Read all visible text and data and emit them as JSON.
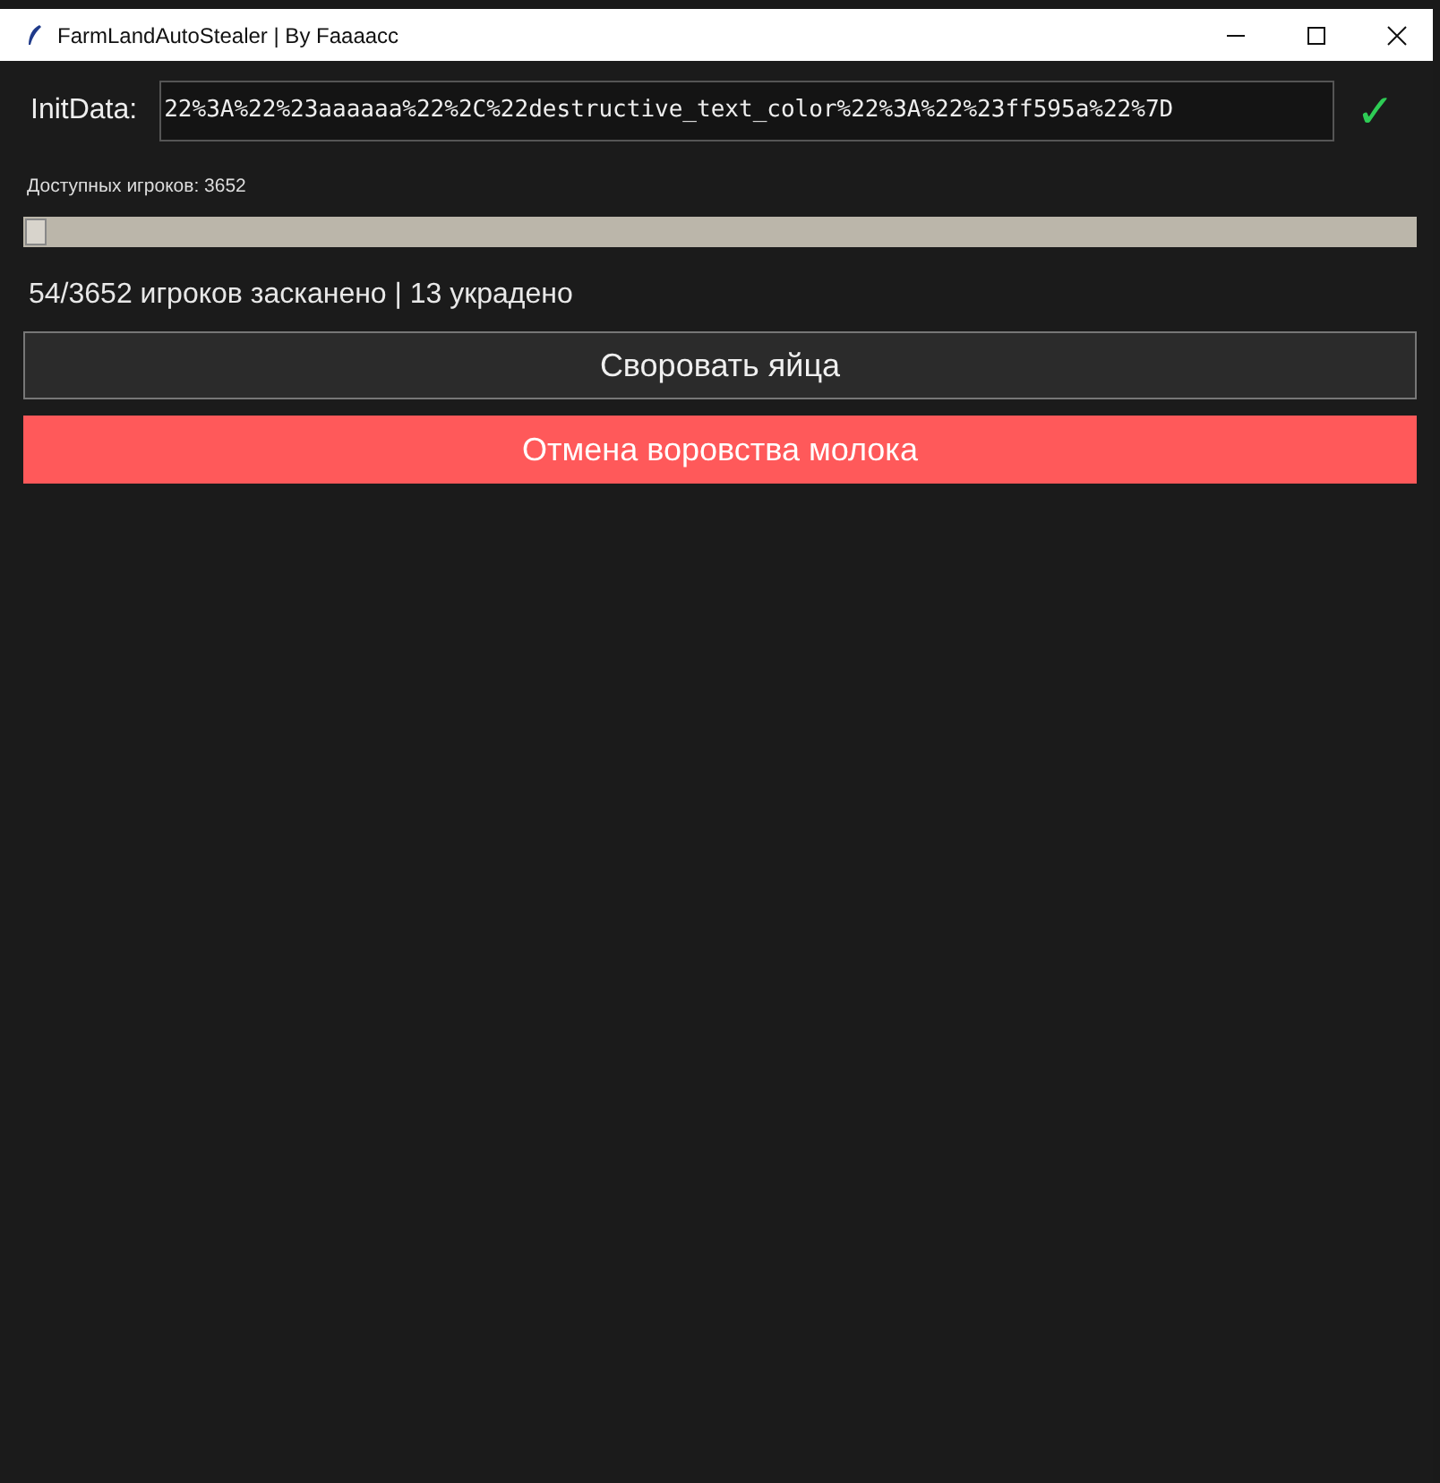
{
  "window": {
    "title": "FarmLandAutoStealer | By Faaaacc"
  },
  "init_data": {
    "label": "InitData:",
    "value": "22%3A%22%23aaaaaa%22%2C%22destructive_text_color%22%3A%22%23ff595a%22%7D",
    "status": "✓"
  },
  "available": "Доступных игроков: 3652",
  "progress": {
    "level": 0.0148
  },
  "status_text": "54/3652 игроков засканено | 13 украдено",
  "buttons": [
    {
      "label": "Своровать яйца",
      "kind": "normal"
    },
    {
      "label": "Отмена воровства молока",
      "kind": "danger"
    }
  ]
}
